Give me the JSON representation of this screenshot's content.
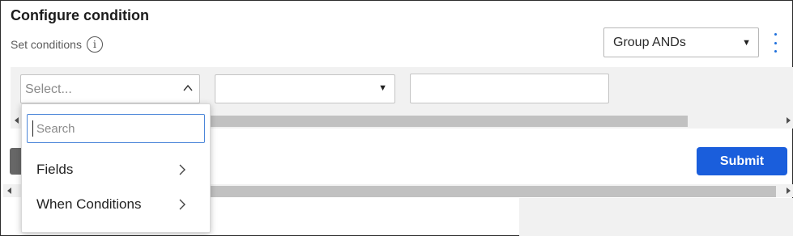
{
  "header": {
    "title": "Configure condition",
    "subtitle": "Set conditions",
    "info_icon": "info-icon"
  },
  "group_select": {
    "value": "Group ANDs"
  },
  "condition_row": {
    "select1_placeholder": "Select...",
    "select2_value": "",
    "input_value": ""
  },
  "dropdown": {
    "search_placeholder": "Search",
    "items": [
      {
        "label": "Fields",
        "icon": "chevron-right-icon"
      },
      {
        "label": "When Conditions",
        "icon": "chevron-right-icon"
      }
    ]
  },
  "actions": {
    "submit_label": "Submit"
  },
  "colors": {
    "accent": "#1a5edc",
    "kebab": "#1e6fdc",
    "panel_bg": "#f1f1f1"
  }
}
